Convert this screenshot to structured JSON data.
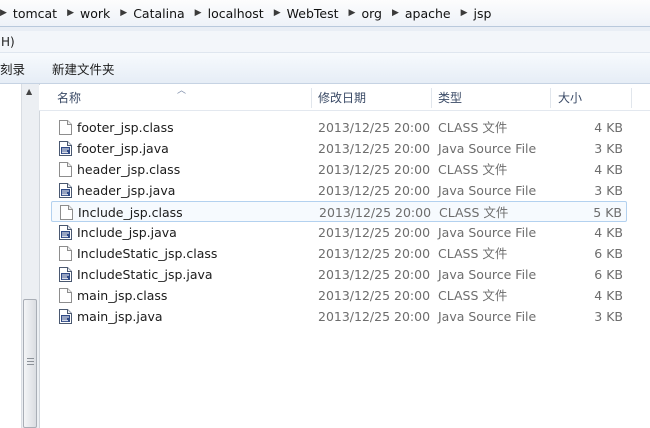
{
  "breadcrumb": [
    "tomcat",
    "work",
    "Catalina",
    "localhost",
    "WebTest",
    "org",
    "apache",
    "jsp"
  ],
  "menu": {
    "help_fragment": "H)"
  },
  "toolbar": {
    "burn_fragment": "刻录",
    "new_folder": "新建文件夹"
  },
  "columns": {
    "name": "名称",
    "date": "修改日期",
    "type": "类型",
    "size": "大小"
  },
  "files": [
    {
      "name": "footer_jsp.class",
      "date": "2013/12/25 20:00",
      "type": "CLASS 文件",
      "size": "4 KB",
      "icon": "class-file-icon"
    },
    {
      "name": "footer_jsp.java",
      "date": "2013/12/25 20:00",
      "type": "Java Source File",
      "size": "3 KB",
      "icon": "java-file-icon"
    },
    {
      "name": "header_jsp.class",
      "date": "2013/12/25 20:00",
      "type": "CLASS 文件",
      "size": "4 KB",
      "icon": "class-file-icon"
    },
    {
      "name": "header_jsp.java",
      "date": "2013/12/25 20:00",
      "type": "Java Source File",
      "size": "3 KB",
      "icon": "java-file-icon"
    },
    {
      "name": "Include_jsp.class",
      "date": "2013/12/25 20:00",
      "type": "CLASS 文件",
      "size": "5 KB",
      "icon": "class-file-icon",
      "selected": true
    },
    {
      "name": "Include_jsp.java",
      "date": "2013/12/25 20:00",
      "type": "Java Source File",
      "size": "4 KB",
      "icon": "java-file-icon"
    },
    {
      "name": "IncludeStatic_jsp.class",
      "date": "2013/12/25 20:00",
      "type": "CLASS 文件",
      "size": "6 KB",
      "icon": "class-file-icon"
    },
    {
      "name": "IncludeStatic_jsp.java",
      "date": "2013/12/25 20:00",
      "type": "Java Source File",
      "size": "6 KB",
      "icon": "java-file-icon"
    },
    {
      "name": "main_jsp.class",
      "date": "2013/12/25 20:00",
      "type": "CLASS 文件",
      "size": "4 KB",
      "icon": "class-file-icon"
    },
    {
      "name": "main_jsp.java",
      "date": "2013/12/25 20:00",
      "type": "Java Source File",
      "size": "3 KB",
      "icon": "java-file-icon"
    }
  ],
  "colors": {
    "selection_border": "#b3d1ef",
    "selection_fill": "#f6fafe",
    "header_text": "#3a4a66"
  }
}
